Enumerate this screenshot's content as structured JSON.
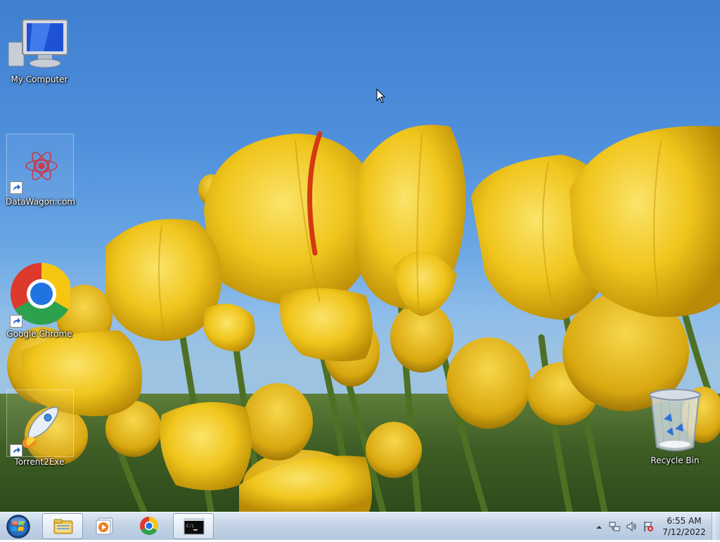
{
  "desktop": {
    "icons": [
      {
        "label": "My Computer",
        "icon": "monitor-icon"
      },
      {
        "label": "DataWagon.com",
        "icon": "datawagon-logo-icon",
        "shortcut": true
      },
      {
        "label": "Google Chrome",
        "icon": "chrome-icon",
        "shortcut": true
      },
      {
        "label": "Torrent2Exe",
        "icon": "rocket-icon",
        "shortcut": true
      },
      {
        "label": "Recycle Bin",
        "icon": "recycle-bin-icon"
      }
    ],
    "wallpaper": "yellow tulips"
  },
  "taskbar": {
    "start": "start-orb-icon",
    "pinned": [
      "file-explorer-icon",
      "media-player-icon",
      "chrome-icon",
      "command-prompt-icon"
    ],
    "active_item": "command-prompt-icon",
    "tray_icons": [
      "show-hidden-icons-chevron",
      "network-icon",
      "volume-icon",
      "action-center-flag-icon"
    ],
    "clock": {
      "time": "6:55 AM",
      "date": "7/12/2022"
    }
  },
  "colors": {
    "sky_top": "#3f7fd0",
    "tulip": "#f2cc1f",
    "taskbar": "#c3d3e6"
  }
}
